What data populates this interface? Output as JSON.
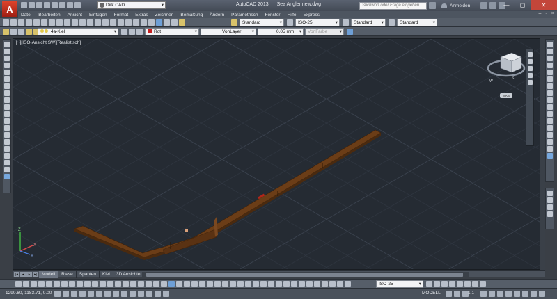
{
  "app": {
    "name": "AutoCAD 2013",
    "document": "Sea Angler new.dwg",
    "workspace": "Dirk CAD",
    "logo_letter": "A"
  },
  "search": {
    "placeholder": "Stichwort oder Frage eingeben"
  },
  "signin": {
    "label": "Anmelden"
  },
  "menu": {
    "items": [
      "Datei",
      "Bearbeiten",
      "Ansicht",
      "Einfügen",
      "Format",
      "Extras",
      "Zeichnen",
      "Bemaßung",
      "Ändern",
      "Parametrisch",
      "Fenster",
      "Hilfe",
      "Express"
    ]
  },
  "styles_toolbar": {
    "text_style": "Standard",
    "dim_style": "ISO-25",
    "table_style": "Standard",
    "mleader_style": "Standard"
  },
  "properties_toolbar": {
    "layer": "4a-Kiel",
    "color": "Rot",
    "color_hex": "#c62020",
    "linetype": "VonLayer",
    "lineweight": "0.05 mm",
    "plotstyle": "VonFarbe"
  },
  "viewport": {
    "label": "[−][ISO-Ansicht SW][Realistisch]",
    "background": "#252b33",
    "model_color": "#5c3414",
    "wcs_label": "WKS"
  },
  "tabs": {
    "items": [
      "Modell",
      "Riese",
      "Spanten",
      "Kiel",
      "3D Ansichten"
    ],
    "active": "Modell"
  },
  "bottom_toolbar": {
    "dim_style": "ISO-25"
  },
  "status": {
    "coordinates": "1290.60, 1183.71, 0.00",
    "space": "MODELL",
    "scale": "1:1"
  },
  "accent": {
    "title_close": "#c3463a",
    "logo_red": "#d63b26"
  }
}
